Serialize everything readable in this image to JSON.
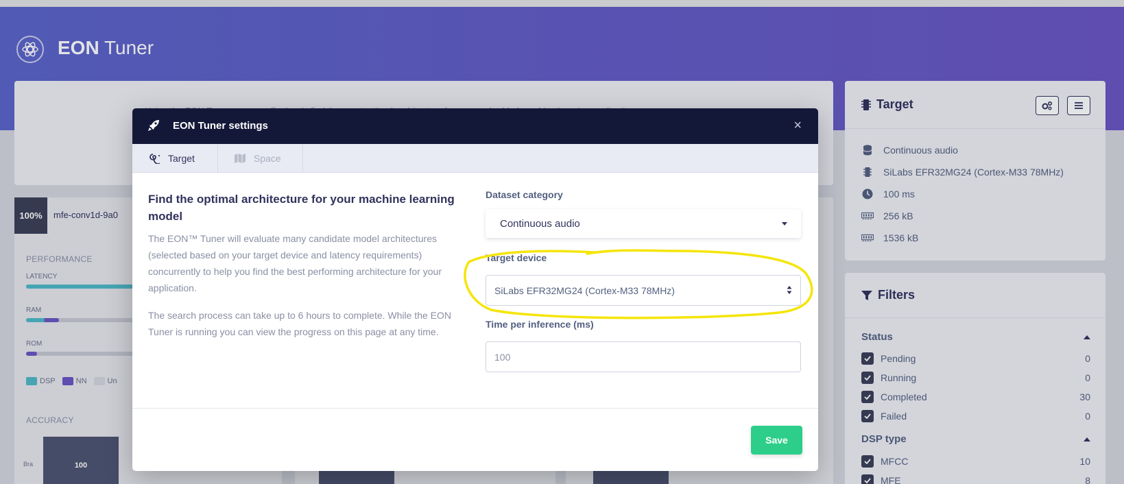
{
  "app": {
    "title_bold": "EON",
    "title_rest": "Tuner"
  },
  "background": {
    "intro_text": "Using the EON Tuner you can effortlessly find the most optimal architecture for your embedded machine learning application.",
    "model_card": {
      "percent": "100%",
      "name": "mfe-conv1d-9a0",
      "performance_label": "PERFORMANCE",
      "latency_label": "LATENCY",
      "ram_label": "RAM",
      "rom_label": "ROM",
      "legend": [
        "DSP",
        "NN",
        "Un"
      ],
      "accuracy_label": "ACCURACY",
      "accuracy_tick": "Bra",
      "accuracy_value": "100"
    }
  },
  "target": {
    "title": "Target",
    "rows": [
      {
        "icon": "database-icon",
        "text": "Continuous audio"
      },
      {
        "icon": "chip-icon",
        "text": "SiLabs EFR32MG24 (Cortex-M33 78MHz)"
      },
      {
        "icon": "clock-icon",
        "text": "100 ms"
      },
      {
        "icon": "memory-icon",
        "text": "256 kB"
      },
      {
        "icon": "memory-icon",
        "text": "1536 kB"
      }
    ]
  },
  "filters": {
    "title": "Filters",
    "status_label": "Status",
    "status": [
      {
        "label": "Pending",
        "count": "0"
      },
      {
        "label": "Running",
        "count": "0"
      },
      {
        "label": "Completed",
        "count": "30"
      },
      {
        "label": "Failed",
        "count": "0"
      }
    ],
    "dsp_label": "DSP type",
    "dsp": [
      {
        "label": "MFCC",
        "count": "10"
      },
      {
        "label": "MFE",
        "count": "8"
      }
    ]
  },
  "modal": {
    "title": "EON Tuner settings",
    "close": "×",
    "tabs": [
      {
        "label": "Target",
        "active": true
      },
      {
        "label": "Space",
        "active": false
      }
    ],
    "heading": "Find the optimal architecture for your machine learning model",
    "p1": "The EON™ Tuner will evaluate many candidate model architectures (selected based on your target device and latency requirements) concurrently to help you find the best performing architecture for your application.",
    "p2": "The search process can take up to 6 hours to complete. While the EON Tuner is running you can view the progress on this page at any time.",
    "dataset_label": "Dataset category",
    "dataset_value": "Continuous audio",
    "device_label": "Target device",
    "device_value": "SiLabs EFR32MG24 (Cortex-M33 78MHz)",
    "time_label": "Time per inference (ms)",
    "time_value": "100",
    "save_label": "Save"
  },
  "colors": {
    "accent": "#5a63c8",
    "save": "#2dce89",
    "modal_header": "#141838",
    "highlight": "#f5e50a"
  }
}
